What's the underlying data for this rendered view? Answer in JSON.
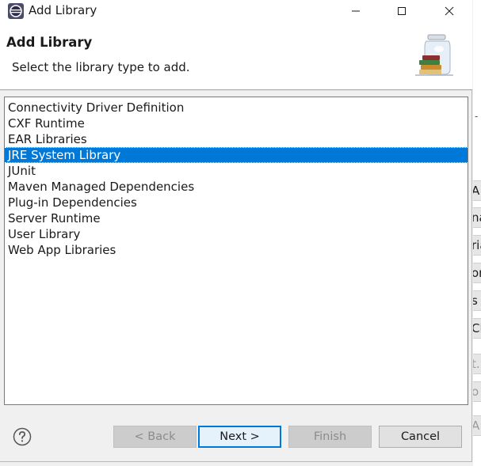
{
  "window": {
    "title": "Add Library",
    "icon": "eclipse-icon"
  },
  "banner": {
    "title": "Add Library",
    "description": "Select the library type to add.",
    "image": "library-jar-icon"
  },
  "library_list": {
    "items": [
      {
        "label": "Connectivity Driver Definition",
        "selected": false
      },
      {
        "label": "CXF Runtime",
        "selected": false
      },
      {
        "label": "EAR Libraries",
        "selected": false
      },
      {
        "label": "JRE System Library",
        "selected": true
      },
      {
        "label": "JUnit",
        "selected": false
      },
      {
        "label": "Maven Managed Dependencies",
        "selected": false
      },
      {
        "label": "Plug-in Dependencies",
        "selected": false
      },
      {
        "label": "Server Runtime",
        "selected": false
      },
      {
        "label": "User Library",
        "selected": false
      },
      {
        "label": "Web App Libraries",
        "selected": false
      }
    ]
  },
  "buttons": {
    "back": "< Back",
    "next": "Next >",
    "finish": "Finish",
    "cancel": "Cancel",
    "help_icon": "help-icon"
  },
  "background_window": {
    "fragments": [
      "A",
      "na",
      "ria",
      "or",
      "s F",
      "Cl",
      "t.",
      "o",
      "A"
    ]
  },
  "colors": {
    "selection": "#0078d7",
    "dialog_bg": "#f0f0f0"
  }
}
